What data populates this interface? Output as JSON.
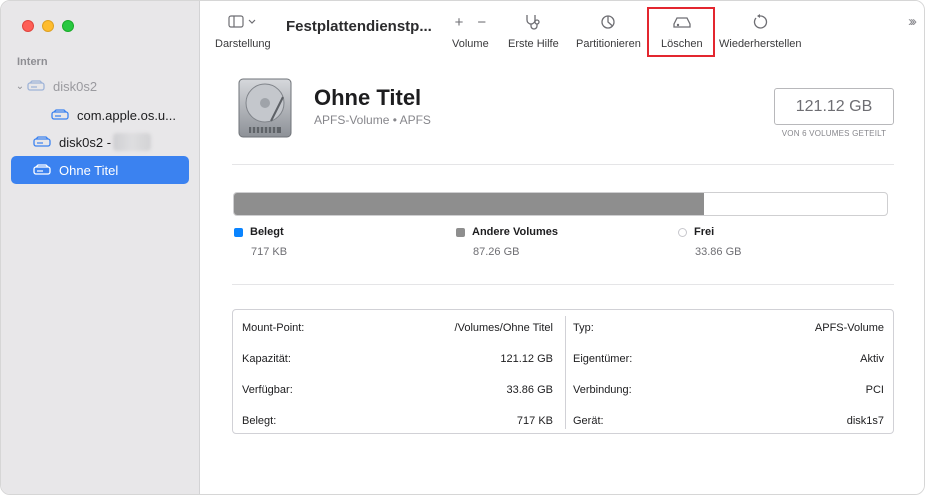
{
  "sidebar": {
    "section": "Intern",
    "items": [
      {
        "label": "disk0s2"
      },
      {
        "label": "com.apple.os.u..."
      },
      {
        "label": "disk0s2 -"
      },
      {
        "label": "Ohne Titel"
      }
    ]
  },
  "toolbar": {
    "view_label": "Darstellung",
    "title": "Festplattendienstp...",
    "volume_label": "Volume",
    "firstaid_label": "Erste Hilfe",
    "partition_label": "Partitionieren",
    "erase_label": "Löschen",
    "restore_label": "Wiederherstellen",
    "plus_glyph": "+",
    "minus_glyph": "−"
  },
  "volume": {
    "name": "Ohne Titel",
    "subtitle": "APFS-Volume • APFS",
    "capacity": "121.12 GB",
    "capacity_note": "VON 6 VOLUMES GETEILT"
  },
  "usage": {
    "used_fraction": 1e-05,
    "other_fraction": 0.7204,
    "legend": [
      {
        "label": "Belegt",
        "value": "717 KB"
      },
      {
        "label": "Andere Volumes",
        "value": "87.26 GB"
      },
      {
        "label": "Frei",
        "value": "33.86 GB"
      }
    ]
  },
  "info": {
    "left": [
      {
        "key": "Mount-Point:",
        "value": "/Volumes/Ohne Titel"
      },
      {
        "key": "Kapazität:",
        "value": "121.12 GB"
      },
      {
        "key": "Verfügbar:",
        "value": "33.86 GB"
      },
      {
        "key": "Belegt:",
        "value": "717 KB"
      }
    ],
    "right": [
      {
        "key": "Typ:",
        "value": "APFS-Volume"
      },
      {
        "key": "Eigentümer:",
        "value": "Aktiv"
      },
      {
        "key": "Verbindung:",
        "value": "PCI"
      },
      {
        "key": "Gerät:",
        "value": "disk1s7"
      }
    ]
  },
  "colors": {
    "accent": "#3b82f0",
    "used": "#0a84ff",
    "other": "#8e8e8e",
    "highlight": "#e3262f"
  }
}
